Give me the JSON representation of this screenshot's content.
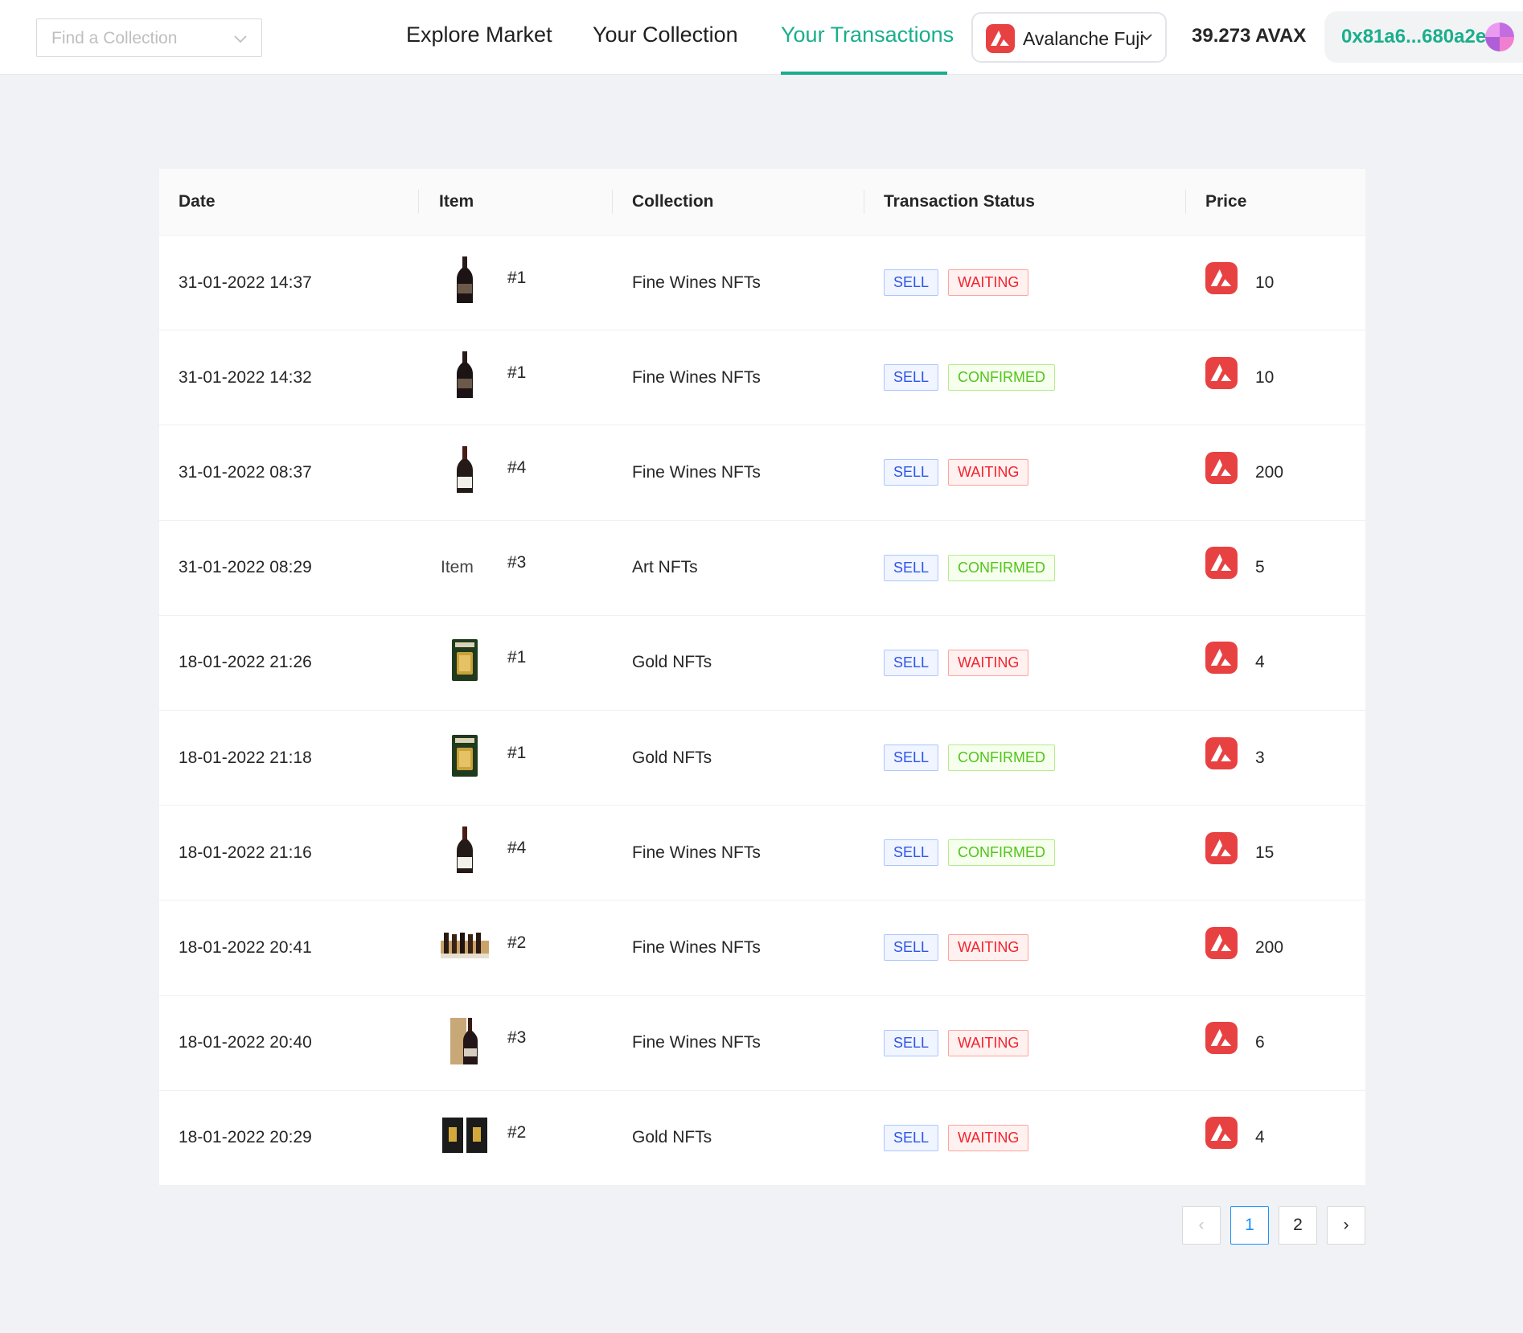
{
  "header": {
    "search": {
      "placeholder": "Find a Collection"
    },
    "nav": [
      {
        "label": "Explore Market",
        "active": false
      },
      {
        "label": "Your Collection",
        "active": false
      },
      {
        "label": "Your Transactions",
        "active": true
      }
    ],
    "network": {
      "label": "Avalanche Fuji",
      "icon": "avalanche-logo-icon"
    },
    "balance": "39.273 AVAX",
    "wallet": {
      "address": "0x81a6...680a2e",
      "avatar": "avatar-icon"
    }
  },
  "colors": {
    "accent": "#1aae8c",
    "avax_red": "#e84142",
    "sell": "#2f54eb",
    "waiting": "#f5222d",
    "confirmed": "#52c41a",
    "pagination_active": "#1890ff"
  },
  "table": {
    "columns": [
      "Date",
      "Item",
      "Collection",
      "Transaction Status",
      "Price"
    ],
    "rows": [
      {
        "date": "31-01-2022 14:37",
        "thumb": "wine-bottle-icon",
        "item": "#1",
        "collection": "Fine Wines NFTs",
        "type": "SELL",
        "status": "WAITING",
        "price": "10"
      },
      {
        "date": "31-01-2022 14:32",
        "thumb": "wine-bottle-icon",
        "item": "#1",
        "collection": "Fine Wines NFTs",
        "type": "SELL",
        "status": "CONFIRMED",
        "price": "10"
      },
      {
        "date": "31-01-2022 08:37",
        "thumb": "wine-bottle-white-label-icon",
        "item": "#4",
        "collection": "Fine Wines NFTs",
        "type": "SELL",
        "status": "WAITING",
        "price": "200"
      },
      {
        "date": "31-01-2022 08:29",
        "thumb": "broken-image",
        "thumb_alt": "Item",
        "item": "#3",
        "collection": "Art NFTs",
        "type": "SELL",
        "status": "CONFIRMED",
        "price": "5"
      },
      {
        "date": "18-01-2022 21:26",
        "thumb": "gold-bar-icon",
        "item": "#1",
        "collection": "Gold NFTs",
        "type": "SELL",
        "status": "WAITING",
        "price": "4"
      },
      {
        "date": "18-01-2022 21:18",
        "thumb": "gold-bar-icon",
        "item": "#1",
        "collection": "Gold NFTs",
        "type": "SELL",
        "status": "CONFIRMED",
        "price": "3"
      },
      {
        "date": "18-01-2022 21:16",
        "thumb": "wine-bottle-white-label-icon",
        "item": "#4",
        "collection": "Fine Wines NFTs",
        "type": "SELL",
        "status": "CONFIRMED",
        "price": "15"
      },
      {
        "date": "18-01-2022 20:41",
        "thumb": "wine-bottles-row-icon",
        "item": "#2",
        "collection": "Fine Wines NFTs",
        "type": "SELL",
        "status": "WAITING",
        "price": "200"
      },
      {
        "date": "18-01-2022 20:40",
        "thumb": "wine-bottle-box-icon",
        "item": "#3",
        "collection": "Fine Wines NFTs",
        "type": "SELL",
        "status": "WAITING",
        "price": "6"
      },
      {
        "date": "18-01-2022 20:29",
        "thumb": "gold-boxes-icon",
        "item": "#2",
        "collection": "Gold NFTs",
        "type": "SELL",
        "status": "WAITING",
        "price": "4"
      }
    ]
  },
  "pagination": {
    "prev": "‹",
    "pages": [
      "1",
      "2"
    ],
    "current": "1",
    "next": "›"
  }
}
